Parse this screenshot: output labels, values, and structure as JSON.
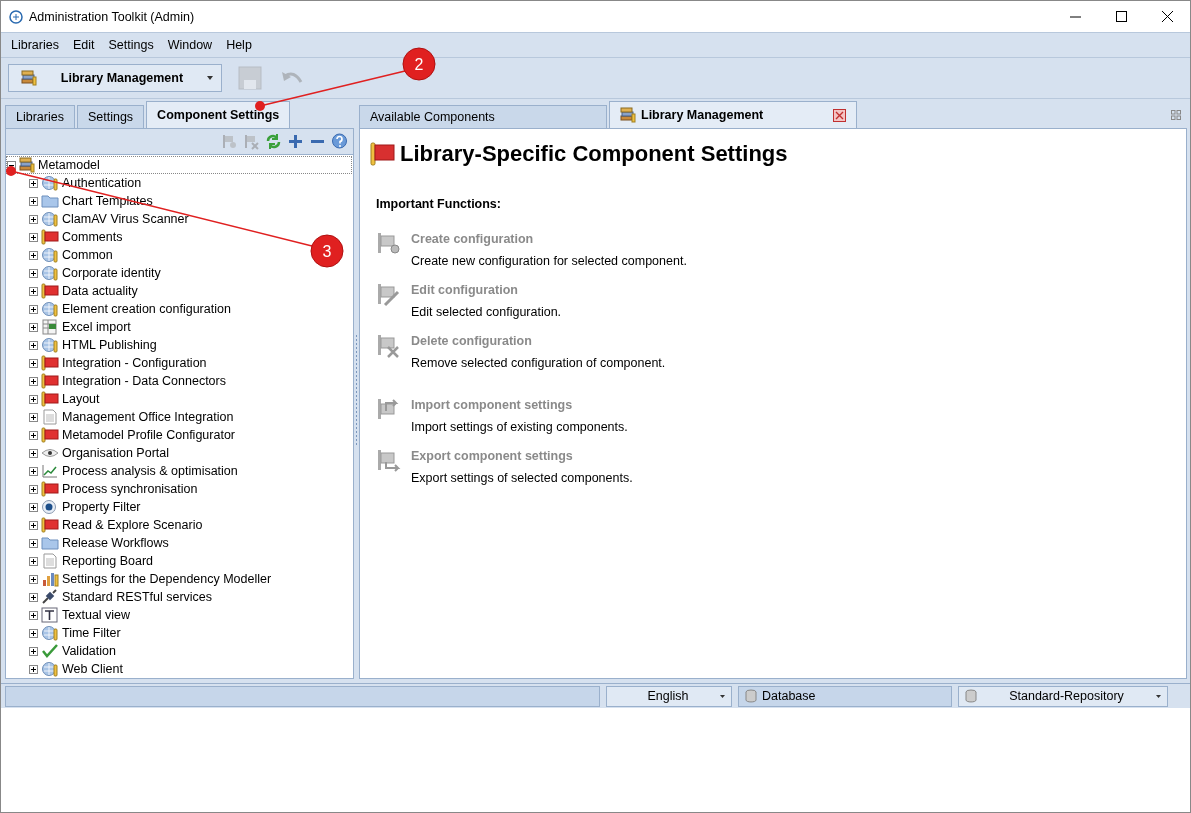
{
  "window": {
    "title": "Administration Toolkit (Admin)"
  },
  "menu": [
    "Libraries",
    "Edit",
    "Settings",
    "Window",
    "Help"
  ],
  "toolbar": {
    "perspective": "Library Management",
    "buttons": [
      {
        "kind": "save",
        "disabled": true
      },
      {
        "kind": "undo",
        "disabled": true
      }
    ]
  },
  "left_tabs": [
    {
      "label": "Libraries",
      "selected": false
    },
    {
      "label": "Settings",
      "selected": false
    },
    {
      "label": "Component Settings",
      "selected": true
    }
  ],
  "tree_tools": [
    {
      "kind": "new",
      "disabled": true
    },
    {
      "kind": "delete",
      "disabled": true
    },
    {
      "kind": "refresh",
      "disabled": false
    },
    {
      "kind": "expand",
      "disabled": false
    },
    {
      "kind": "collapse",
      "disabled": false
    },
    {
      "kind": "help",
      "disabled": false
    }
  ],
  "tree": {
    "label": "Metamodel",
    "kind": "library",
    "expanded": true,
    "selected": true,
    "children": [
      {
        "label": "Authentication",
        "kind": "globe",
        "expanded": false,
        "selected": false
      },
      {
        "label": "Chart Templates",
        "kind": "folder",
        "expanded": false,
        "selected": false
      },
      {
        "label": "ClamAV Virus Scanner",
        "kind": "globe",
        "expanded": false,
        "selected": false
      },
      {
        "label": "Comments",
        "kind": "flag",
        "expanded": false,
        "selected": false
      },
      {
        "label": "Common",
        "kind": "globe",
        "expanded": false,
        "selected": false
      },
      {
        "label": "Corporate identity",
        "kind": "globe",
        "expanded": false,
        "selected": false
      },
      {
        "label": "Data actuality",
        "kind": "flag",
        "expanded": false,
        "selected": false
      },
      {
        "label": "Element creation configuration",
        "kind": "globe",
        "expanded": false,
        "selected": false
      },
      {
        "label": "Excel import",
        "kind": "sheet",
        "expanded": false,
        "selected": false
      },
      {
        "label": "HTML Publishing",
        "kind": "globe",
        "expanded": false,
        "selected": false
      },
      {
        "label": "Integration - Configuration",
        "kind": "flag",
        "expanded": false,
        "selected": false
      },
      {
        "label": "Integration - Data Connectors",
        "kind": "flag",
        "expanded": false,
        "selected": false
      },
      {
        "label": "Layout",
        "kind": "flag",
        "expanded": false,
        "selected": false
      },
      {
        "label": "Management Office Integration",
        "kind": "document",
        "expanded": false,
        "selected": false
      },
      {
        "label": "Metamodel Profile Configurator",
        "kind": "flag",
        "expanded": false,
        "selected": false
      },
      {
        "label": "Organisation Portal",
        "kind": "eye",
        "expanded": false,
        "selected": false
      },
      {
        "label": "Process analysis & optimisation",
        "kind": "chart",
        "expanded": false,
        "selected": false
      },
      {
        "label": "Process synchronisation",
        "kind": "flag",
        "expanded": false,
        "selected": false
      },
      {
        "label": "Property Filter",
        "kind": "radio",
        "expanded": false,
        "selected": false
      },
      {
        "label": "Read & Explore Scenario",
        "kind": "flag",
        "expanded": false,
        "selected": false
      },
      {
        "label": "Release Workflows",
        "kind": "folder",
        "expanded": false,
        "selected": false
      },
      {
        "label": "Reporting Board",
        "kind": "document",
        "expanded": false,
        "selected": false
      },
      {
        "label": "Settings for the Dependency Modeller",
        "kind": "bars",
        "expanded": false,
        "selected": false
      },
      {
        "label": "Standard RESTful services",
        "kind": "plug",
        "expanded": false,
        "selected": false
      },
      {
        "label": "Textual view",
        "kind": "text",
        "expanded": false,
        "selected": false
      },
      {
        "label": "Time Filter",
        "kind": "globe",
        "expanded": false,
        "selected": false
      },
      {
        "label": "Validation",
        "kind": "check",
        "expanded": false,
        "selected": false
      },
      {
        "label": "Web Client",
        "kind": "globe",
        "expanded": false,
        "selected": false
      }
    ]
  },
  "right_tabs": [
    {
      "label": "Available Components",
      "selected": false,
      "closable": false,
      "kind": "plain"
    },
    {
      "label": "Library Management",
      "selected": true,
      "closable": true,
      "kind": "library"
    }
  ],
  "content": {
    "heading": "Library-Specific Component Settings",
    "subheading": "Important Functions:",
    "function_groups": [
      [
        {
          "kind": "create",
          "title": "Create configuration",
          "description": "Create new configuration for selected component.",
          "disabled": true
        },
        {
          "kind": "edit",
          "title": "Edit configuration",
          "description": "Edit selected configuration.",
          "disabled": true
        },
        {
          "kind": "delete",
          "title": "Delete configuration",
          "description": "Remove selected configuration of component.",
          "disabled": true
        }
      ],
      [
        {
          "kind": "import",
          "title": "Import component settings",
          "description": "Import settings of existing components.",
          "disabled": true
        },
        {
          "kind": "export",
          "title": "Export component settings",
          "description": "Export settings of selected components.",
          "disabled": true
        }
      ]
    ]
  },
  "status_bar": {
    "language": "English",
    "connection": "Database",
    "repository": "Standard-Repository"
  },
  "callouts": [
    {
      "number": "2"
    },
    {
      "number": "3"
    }
  ]
}
